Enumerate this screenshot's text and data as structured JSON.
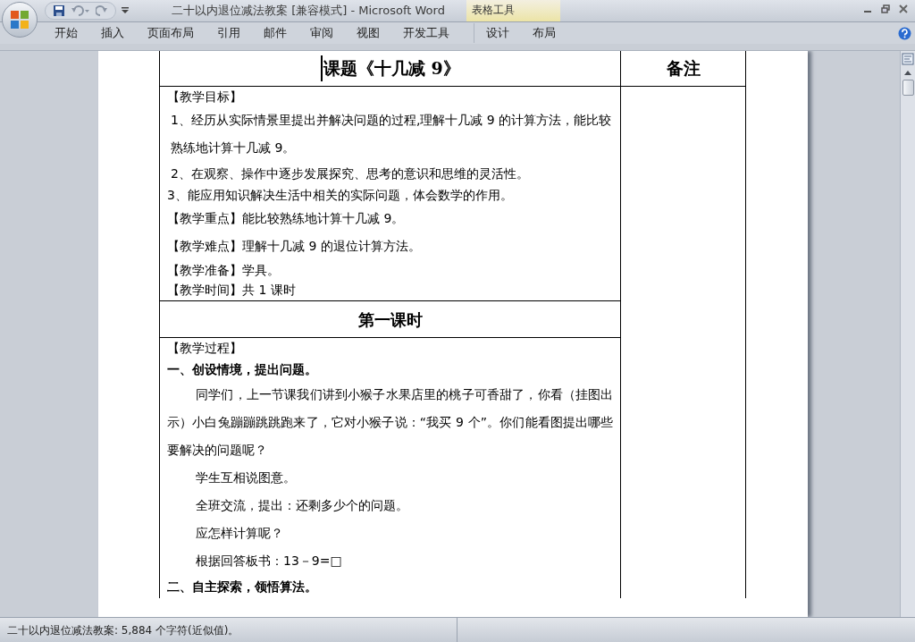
{
  "window": {
    "title": "二十以内退位减法教案 [兼容模式] - Microsoft Word",
    "context_label": "表格工具"
  },
  "ribbon_tabs": [
    {
      "label": "开始",
      "selected": false
    },
    {
      "label": "插入",
      "selected": false
    },
    {
      "label": "页面布局",
      "selected": false
    },
    {
      "label": "引用",
      "selected": false
    },
    {
      "label": "邮件",
      "selected": false
    },
    {
      "label": "审阅",
      "selected": false
    },
    {
      "label": "视图",
      "selected": false
    },
    {
      "label": "开发工具",
      "selected": false
    },
    {
      "label": "设计",
      "selected": false,
      "contextual": true
    },
    {
      "label": "布局",
      "selected": false,
      "contextual": true
    }
  ],
  "document": {
    "title": "课题《十几减 9》",
    "notes_header": "备注",
    "objectives": [
      {
        "kind": "tight",
        "text": "【教学目标】"
      },
      {
        "kind": "wrap",
        "text": "1、经历从实际情景里提出并解决问题的过程,理解十几减 9 的计算方法，能比较熟练地计算十几减 9。"
      },
      {
        "kind": "normal",
        "text": "2、在观察、操作中逐步发展探究、思考的意识和思维的灵活性。"
      },
      {
        "kind": "tight",
        "text": "3、能应用知识解决生活中相关的实际问题，体会数学的作用。"
      },
      {
        "kind": "loose",
        "text": "【教学重点】能比较熟练地计算十几减 9。"
      },
      {
        "kind": "loose",
        "text": "【教学难点】理解十几减 9 的退位计算方法。"
      },
      {
        "kind": "tight",
        "text": "【教学准备】学具。"
      },
      {
        "kind": "tight",
        "text": "【教学时间】共 1 课时"
      }
    ],
    "section_heading": "第一课时",
    "process": [
      {
        "kind": "tight",
        "text": "【教学过程】"
      },
      {
        "kind": "heading",
        "text": "一、创设情境，提出问题。"
      },
      {
        "kind": "indent-wrap",
        "text": "同学们，上一节课我们讲到小猴子水果店里的桃子可香甜了，你看（挂图出示）小白兔蹦蹦跳跳跑来了，它对小猴子说：“我买 9 个”。你们能看图提出哪些要解决的问题呢？"
      },
      {
        "kind": "indent",
        "text": "学生互相说图意。"
      },
      {
        "kind": "indent",
        "text": "全班交流，提出：还剩多少个的问题。"
      },
      {
        "kind": "indent",
        "text": "应怎样计算呢？"
      },
      {
        "kind": "indent",
        "text": "根据回答板书：13－9=□"
      },
      {
        "kind": "heading",
        "text": "二、自主探索，领悟算法。"
      }
    ]
  },
  "status_bar": {
    "text": "二十以内退位减法教案: 5,884 个字符(近似值)。"
  }
}
